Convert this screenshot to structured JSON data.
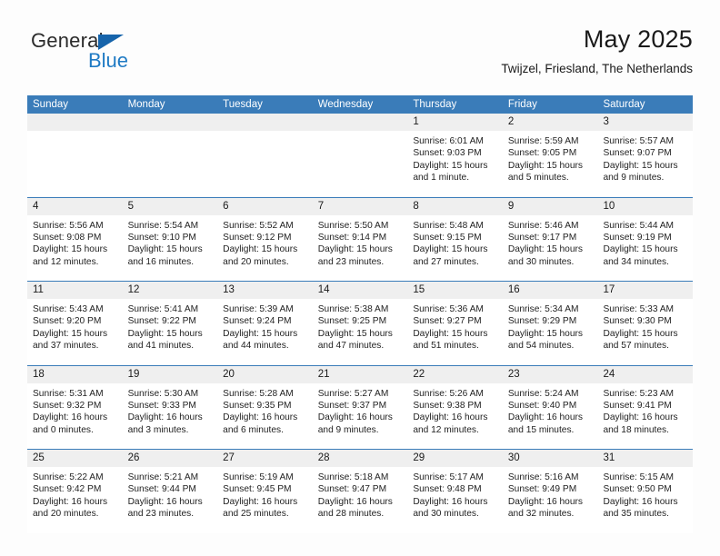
{
  "brand": {
    "word_one": "General",
    "word_two": "Blue",
    "triangle_icon": "brand-triangle-icon"
  },
  "header": {
    "title": "May 2025",
    "subtitle": "Twijzel, Friesland, The Netherlands"
  },
  "colors": {
    "header_blue": "#3a7cb9",
    "brand_blue": "#1f7ac4",
    "triangle_blue": "#1664ab",
    "daynum_band": "#efefef",
    "text": "#1a1a1a"
  },
  "weekdays": [
    "Sunday",
    "Monday",
    "Tuesday",
    "Wednesday",
    "Thursday",
    "Friday",
    "Saturday"
  ],
  "weeks": [
    [
      {
        "day": "",
        "sunrise": "",
        "sunset": "",
        "daylight_1": "",
        "daylight_2": ""
      },
      {
        "day": "",
        "sunrise": "",
        "sunset": "",
        "daylight_1": "",
        "daylight_2": ""
      },
      {
        "day": "",
        "sunrise": "",
        "sunset": "",
        "daylight_1": "",
        "daylight_2": ""
      },
      {
        "day": "",
        "sunrise": "",
        "sunset": "",
        "daylight_1": "",
        "daylight_2": ""
      },
      {
        "day": "1",
        "sunrise": "Sunrise: 6:01 AM",
        "sunset": "Sunset: 9:03 PM",
        "daylight_1": "Daylight: 15 hours",
        "daylight_2": "and 1 minute."
      },
      {
        "day": "2",
        "sunrise": "Sunrise: 5:59 AM",
        "sunset": "Sunset: 9:05 PM",
        "daylight_1": "Daylight: 15 hours",
        "daylight_2": "and 5 minutes."
      },
      {
        "day": "3",
        "sunrise": "Sunrise: 5:57 AM",
        "sunset": "Sunset: 9:07 PM",
        "daylight_1": "Daylight: 15 hours",
        "daylight_2": "and 9 minutes."
      }
    ],
    [
      {
        "day": "4",
        "sunrise": "Sunrise: 5:56 AM",
        "sunset": "Sunset: 9:08 PM",
        "daylight_1": "Daylight: 15 hours",
        "daylight_2": "and 12 minutes."
      },
      {
        "day": "5",
        "sunrise": "Sunrise: 5:54 AM",
        "sunset": "Sunset: 9:10 PM",
        "daylight_1": "Daylight: 15 hours",
        "daylight_2": "and 16 minutes."
      },
      {
        "day": "6",
        "sunrise": "Sunrise: 5:52 AM",
        "sunset": "Sunset: 9:12 PM",
        "daylight_1": "Daylight: 15 hours",
        "daylight_2": "and 20 minutes."
      },
      {
        "day": "7",
        "sunrise": "Sunrise: 5:50 AM",
        "sunset": "Sunset: 9:14 PM",
        "daylight_1": "Daylight: 15 hours",
        "daylight_2": "and 23 minutes."
      },
      {
        "day": "8",
        "sunrise": "Sunrise: 5:48 AM",
        "sunset": "Sunset: 9:15 PM",
        "daylight_1": "Daylight: 15 hours",
        "daylight_2": "and 27 minutes."
      },
      {
        "day": "9",
        "sunrise": "Sunrise: 5:46 AM",
        "sunset": "Sunset: 9:17 PM",
        "daylight_1": "Daylight: 15 hours",
        "daylight_2": "and 30 minutes."
      },
      {
        "day": "10",
        "sunrise": "Sunrise: 5:44 AM",
        "sunset": "Sunset: 9:19 PM",
        "daylight_1": "Daylight: 15 hours",
        "daylight_2": "and 34 minutes."
      }
    ],
    [
      {
        "day": "11",
        "sunrise": "Sunrise: 5:43 AM",
        "sunset": "Sunset: 9:20 PM",
        "daylight_1": "Daylight: 15 hours",
        "daylight_2": "and 37 minutes."
      },
      {
        "day": "12",
        "sunrise": "Sunrise: 5:41 AM",
        "sunset": "Sunset: 9:22 PM",
        "daylight_1": "Daylight: 15 hours",
        "daylight_2": "and 41 minutes."
      },
      {
        "day": "13",
        "sunrise": "Sunrise: 5:39 AM",
        "sunset": "Sunset: 9:24 PM",
        "daylight_1": "Daylight: 15 hours",
        "daylight_2": "and 44 minutes."
      },
      {
        "day": "14",
        "sunrise": "Sunrise: 5:38 AM",
        "sunset": "Sunset: 9:25 PM",
        "daylight_1": "Daylight: 15 hours",
        "daylight_2": "and 47 minutes."
      },
      {
        "day": "15",
        "sunrise": "Sunrise: 5:36 AM",
        "sunset": "Sunset: 9:27 PM",
        "daylight_1": "Daylight: 15 hours",
        "daylight_2": "and 51 minutes."
      },
      {
        "day": "16",
        "sunrise": "Sunrise: 5:34 AM",
        "sunset": "Sunset: 9:29 PM",
        "daylight_1": "Daylight: 15 hours",
        "daylight_2": "and 54 minutes."
      },
      {
        "day": "17",
        "sunrise": "Sunrise: 5:33 AM",
        "sunset": "Sunset: 9:30 PM",
        "daylight_1": "Daylight: 15 hours",
        "daylight_2": "and 57 minutes."
      }
    ],
    [
      {
        "day": "18",
        "sunrise": "Sunrise: 5:31 AM",
        "sunset": "Sunset: 9:32 PM",
        "daylight_1": "Daylight: 16 hours",
        "daylight_2": "and 0 minutes."
      },
      {
        "day": "19",
        "sunrise": "Sunrise: 5:30 AM",
        "sunset": "Sunset: 9:33 PM",
        "daylight_1": "Daylight: 16 hours",
        "daylight_2": "and 3 minutes."
      },
      {
        "day": "20",
        "sunrise": "Sunrise: 5:28 AM",
        "sunset": "Sunset: 9:35 PM",
        "daylight_1": "Daylight: 16 hours",
        "daylight_2": "and 6 minutes."
      },
      {
        "day": "21",
        "sunrise": "Sunrise: 5:27 AM",
        "sunset": "Sunset: 9:37 PM",
        "daylight_1": "Daylight: 16 hours",
        "daylight_2": "and 9 minutes."
      },
      {
        "day": "22",
        "sunrise": "Sunrise: 5:26 AM",
        "sunset": "Sunset: 9:38 PM",
        "daylight_1": "Daylight: 16 hours",
        "daylight_2": "and 12 minutes."
      },
      {
        "day": "23",
        "sunrise": "Sunrise: 5:24 AM",
        "sunset": "Sunset: 9:40 PM",
        "daylight_1": "Daylight: 16 hours",
        "daylight_2": "and 15 minutes."
      },
      {
        "day": "24",
        "sunrise": "Sunrise: 5:23 AM",
        "sunset": "Sunset: 9:41 PM",
        "daylight_1": "Daylight: 16 hours",
        "daylight_2": "and 18 minutes."
      }
    ],
    [
      {
        "day": "25",
        "sunrise": "Sunrise: 5:22 AM",
        "sunset": "Sunset: 9:42 PM",
        "daylight_1": "Daylight: 16 hours",
        "daylight_2": "and 20 minutes."
      },
      {
        "day": "26",
        "sunrise": "Sunrise: 5:21 AM",
        "sunset": "Sunset: 9:44 PM",
        "daylight_1": "Daylight: 16 hours",
        "daylight_2": "and 23 minutes."
      },
      {
        "day": "27",
        "sunrise": "Sunrise: 5:19 AM",
        "sunset": "Sunset: 9:45 PM",
        "daylight_1": "Daylight: 16 hours",
        "daylight_2": "and 25 minutes."
      },
      {
        "day": "28",
        "sunrise": "Sunrise: 5:18 AM",
        "sunset": "Sunset: 9:47 PM",
        "daylight_1": "Daylight: 16 hours",
        "daylight_2": "and 28 minutes."
      },
      {
        "day": "29",
        "sunrise": "Sunrise: 5:17 AM",
        "sunset": "Sunset: 9:48 PM",
        "daylight_1": "Daylight: 16 hours",
        "daylight_2": "and 30 minutes."
      },
      {
        "day": "30",
        "sunrise": "Sunrise: 5:16 AM",
        "sunset": "Sunset: 9:49 PM",
        "daylight_1": "Daylight: 16 hours",
        "daylight_2": "and 32 minutes."
      },
      {
        "day": "31",
        "sunrise": "Sunrise: 5:15 AM",
        "sunset": "Sunset: 9:50 PM",
        "daylight_1": "Daylight: 16 hours",
        "daylight_2": "and 35 minutes."
      }
    ]
  ]
}
